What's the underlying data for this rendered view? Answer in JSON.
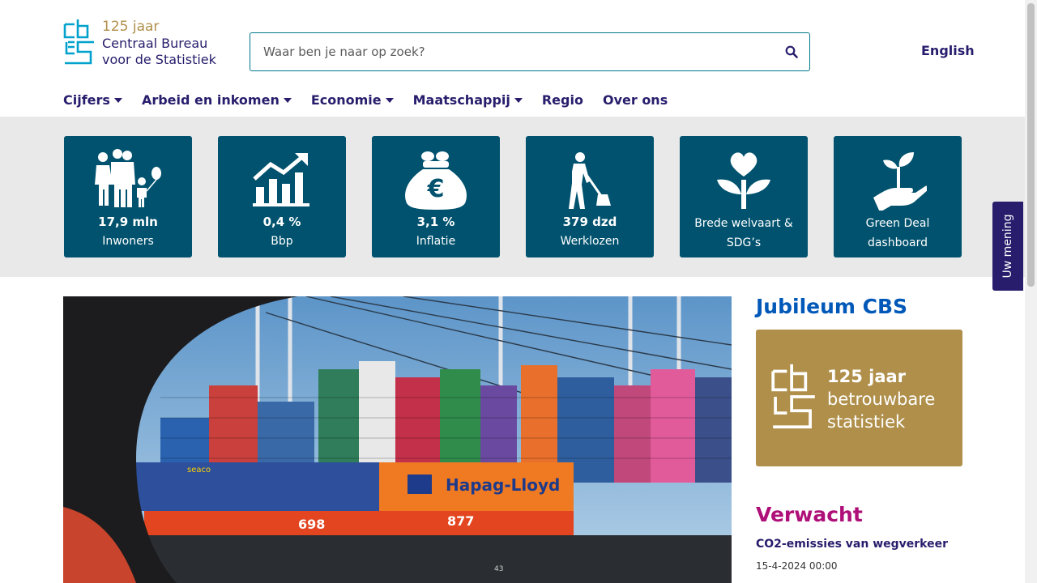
{
  "header": {
    "logo_jaar": "125 jaar",
    "logo_line1": "Centraal Bureau",
    "logo_line2": "voor de Statistiek",
    "search_placeholder": "Waar ben je naar op zoek?",
    "language_link": "English"
  },
  "nav": {
    "items": [
      {
        "label": "Cijfers",
        "dropdown": true
      },
      {
        "label": "Arbeid en inkomen",
        "dropdown": true
      },
      {
        "label": "Economie",
        "dropdown": true
      },
      {
        "label": "Maatschappij",
        "dropdown": true
      },
      {
        "label": "Regio",
        "dropdown": false
      },
      {
        "label": "Over ons",
        "dropdown": false
      }
    ]
  },
  "tiles": [
    {
      "icon": "family-icon",
      "value": "17,9 mln",
      "label": "Inwoners"
    },
    {
      "icon": "growth-chart-icon",
      "value": "0,4 %",
      "label": "Bbp"
    },
    {
      "icon": "euro-bag-icon",
      "value": "3,1 %",
      "label": "Inflatie"
    },
    {
      "icon": "worker-shovel-icon",
      "value": "379 dzd",
      "label": "Werklozen"
    },
    {
      "icon": "heart-plant-icon",
      "value": "",
      "label": "Brede welvaart & SDG’s"
    },
    {
      "icon": "hand-sprout-icon",
      "value": "",
      "label": "Green Deal dashboard"
    }
  ],
  "sidebar": {
    "jubileum_title": "Jubileum CBS",
    "jubileum_card": {
      "line1": "125 jaar",
      "line2": "betrouwbare",
      "line3": "statistiek"
    },
    "verwacht_title": "Verwacht",
    "verwacht_item": "CO2-emissies van wegverkeer",
    "verwacht_date": "15-4-2024 00:00"
  },
  "hero": {
    "container_brand": "Hapag-Lloyd",
    "container_number_1": "698",
    "container_number_2": "877",
    "container_brand_2": "seaco",
    "ground_marker": "43"
  },
  "feedback_tab": "Uw mening",
  "colors": {
    "brand_navy": "#271d6c",
    "tile_blue": "#00526e",
    "gold": "#af8f4a",
    "jubileum_blue": "#0058b8",
    "verwacht_magenta": "#af0f78",
    "search_border": "#00788a"
  }
}
